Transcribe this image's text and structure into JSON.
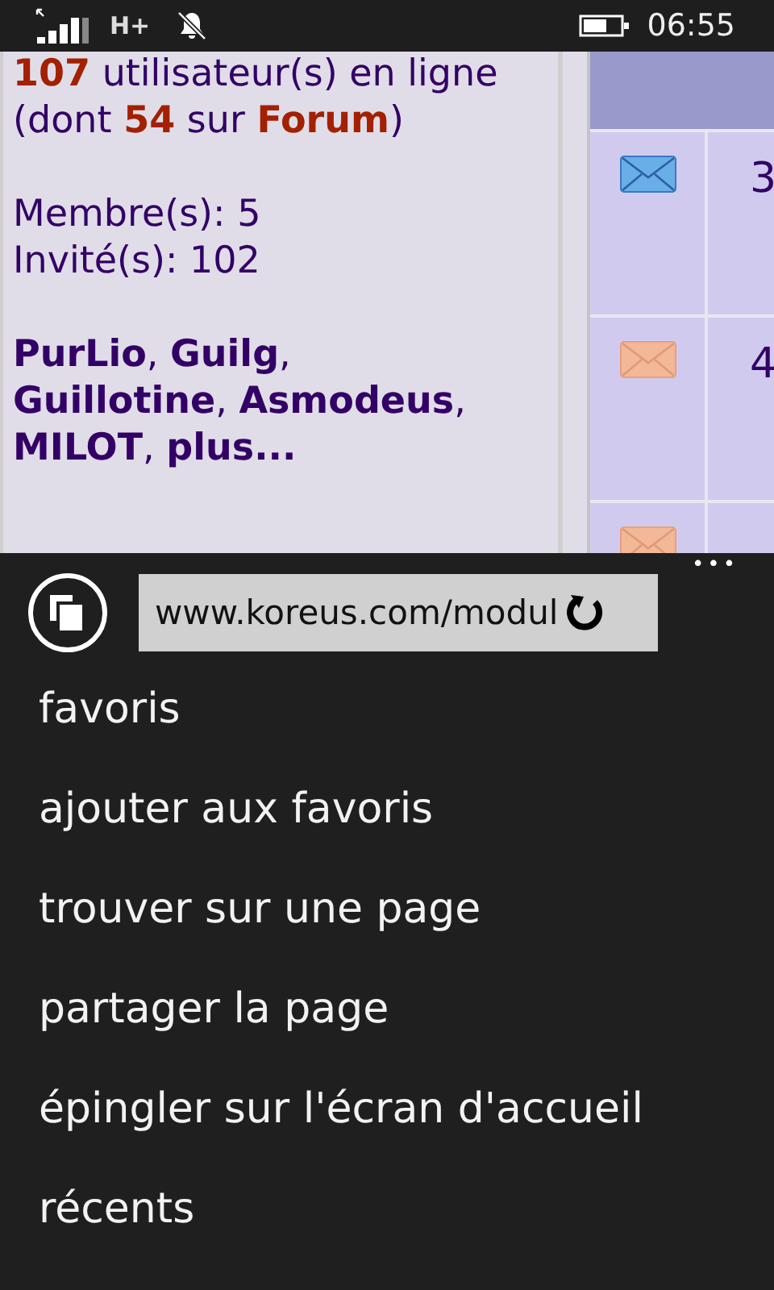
{
  "status_bar": {
    "network": "H+",
    "time": "06:55"
  },
  "page": {
    "online_summary": "**107** utilisateur(s) en ligne (dont **54** sur **Forum**)",
    "members": "Membre(s): 5",
    "guests": "Invité(s): 102",
    "names": "**PurLio**, **Guilg**, **Guillotine**, **Asmodeus**, **MILOT**, **plus...**",
    "rows": [
      {
        "new": true,
        "count": "3"
      },
      {
        "new": false,
        "count": "4"
      },
      {
        "new": false
      }
    ]
  },
  "browser": {
    "address": "www.koreus.com/modul",
    "more": "•••",
    "menu": [
      "favoris",
      "ajouter aux favoris",
      "trouver sur une page",
      "partager la page",
      "épingler sur l'écran d'accueil",
      "récents"
    ]
  }
}
